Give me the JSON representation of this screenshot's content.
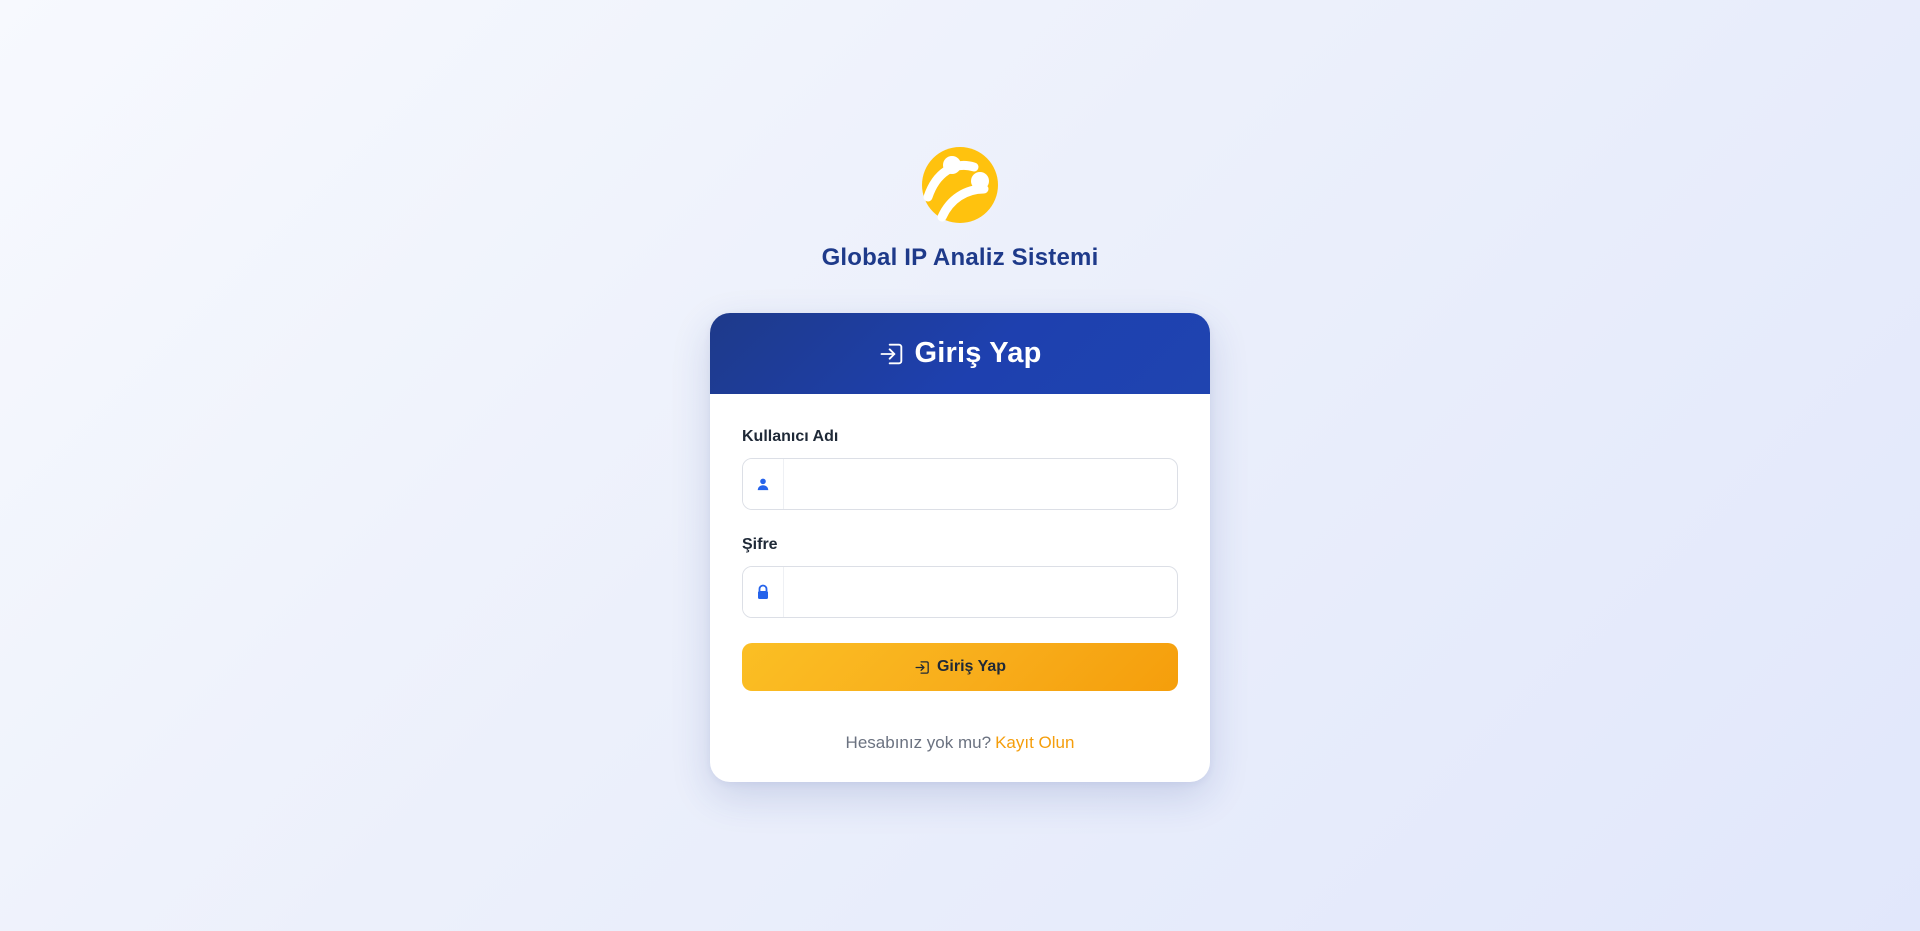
{
  "brand": {
    "title": "Global IP Analiz Sistemi",
    "logo_icon": "turkcell-logo-icon",
    "logo_color": "#ffc20e"
  },
  "card": {
    "header_title": "Giriş Yap",
    "header_icon": "login-icon",
    "header_color": "#1e3a8a"
  },
  "form": {
    "username": {
      "label": "Kullanıcı Adı",
      "value": "",
      "placeholder": "",
      "icon": "user-icon"
    },
    "password": {
      "label": "Şifre",
      "value": "",
      "placeholder": "",
      "icon": "lock-icon"
    },
    "submit_label": "Giriş Yap",
    "submit_icon": "login-icon",
    "submit_color": "#fbbf24"
  },
  "register": {
    "prompt": "Hesabınız yok mu?",
    "link_label": "Kayıt Olun",
    "link_color": "#f59e0b"
  }
}
